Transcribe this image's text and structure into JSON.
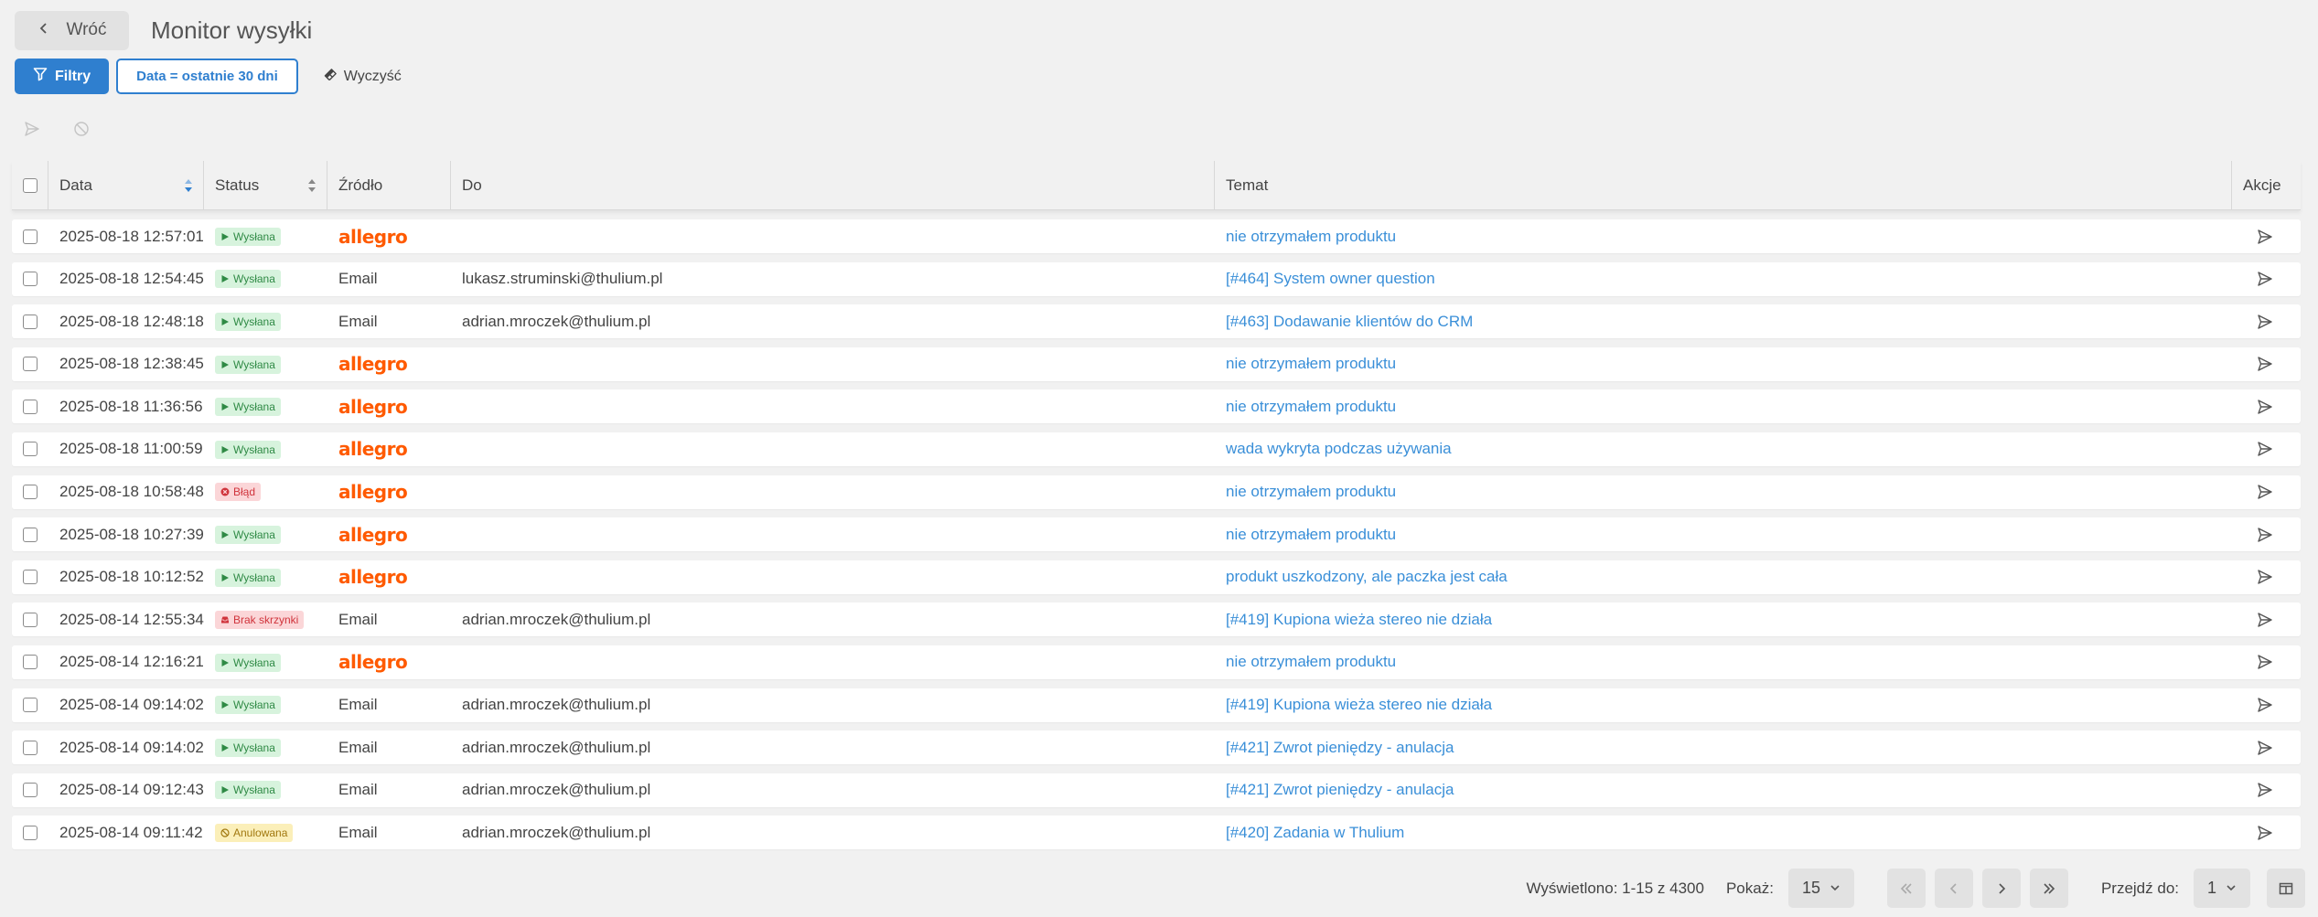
{
  "header": {
    "back_label": "Wróć",
    "title": "Monitor wysyłki"
  },
  "filters": {
    "filter_button": "Filtry",
    "active_chip": "Data = ostatnie 30 dni",
    "clear_button": "Wyczyść"
  },
  "table": {
    "columns": {
      "date": "Data",
      "status": "Status",
      "source": "Źródło",
      "to": "Do",
      "subject": "Temat",
      "actions": "Akcje"
    },
    "rows": [
      {
        "date": "2025-08-18 12:57:01",
        "status": "Wysłana",
        "status_kind": "sent",
        "source": "allegro",
        "to": "",
        "subject": "nie otrzymałem produktu"
      },
      {
        "date": "2025-08-18 12:54:45",
        "status": "Wysłana",
        "status_kind": "sent",
        "source": "Email",
        "to": "lukasz.struminski@thulium.pl",
        "subject": "[#464] System owner question"
      },
      {
        "date": "2025-08-18 12:48:18",
        "status": "Wysłana",
        "status_kind": "sent",
        "source": "Email",
        "to": "adrian.mroczek@thulium.pl",
        "subject": "[#463] Dodawanie klientów do CRM"
      },
      {
        "date": "2025-08-18 12:38:45",
        "status": "Wysłana",
        "status_kind": "sent",
        "source": "allegro",
        "to": "",
        "subject": "nie otrzymałem produktu"
      },
      {
        "date": "2025-08-18 11:36:56",
        "status": "Wysłana",
        "status_kind": "sent",
        "source": "allegro",
        "to": "",
        "subject": "nie otrzymałem produktu"
      },
      {
        "date": "2025-08-18 11:00:59",
        "status": "Wysłana",
        "status_kind": "sent",
        "source": "allegro",
        "to": "",
        "subject": "wada wykryta podczas używania"
      },
      {
        "date": "2025-08-18 10:58:48",
        "status": "Błąd",
        "status_kind": "error",
        "source": "allegro",
        "to": "",
        "subject": "nie otrzymałem produktu"
      },
      {
        "date": "2025-08-18 10:27:39",
        "status": "Wysłana",
        "status_kind": "sent",
        "source": "allegro",
        "to": "",
        "subject": "nie otrzymałem produktu"
      },
      {
        "date": "2025-08-18 10:12:52",
        "status": "Wysłana",
        "status_kind": "sent",
        "source": "allegro",
        "to": "",
        "subject": "produkt uszkodzony, ale paczka jest cała"
      },
      {
        "date": "2025-08-14 12:55:34",
        "status": "Brak skrzynki",
        "status_kind": "nobox",
        "source": "Email",
        "to": "adrian.mroczek@thulium.pl",
        "subject": "[#419] Kupiona wieża stereo nie działa"
      },
      {
        "date": "2025-08-14 12:16:21",
        "status": "Wysłana",
        "status_kind": "sent",
        "source": "allegro",
        "to": "",
        "subject": "nie otrzymałem produktu"
      },
      {
        "date": "2025-08-14 09:14:02",
        "status": "Wysłana",
        "status_kind": "sent",
        "source": "Email",
        "to": "adrian.mroczek@thulium.pl",
        "subject": "[#419] Kupiona wieża stereo nie działa"
      },
      {
        "date": "2025-08-14 09:14:02",
        "status": "Wysłana",
        "status_kind": "sent",
        "source": "Email",
        "to": "adrian.mroczek@thulium.pl",
        "subject": "[#421] Zwrot pieniędzy - anulacja"
      },
      {
        "date": "2025-08-14 09:12:43",
        "status": "Wysłana",
        "status_kind": "sent",
        "source": "Email",
        "to": "adrian.mroczek@thulium.pl",
        "subject": "[#421] Zwrot pieniędzy - anulacja"
      },
      {
        "date": "2025-08-14 09:11:42",
        "status": "Anulowana",
        "status_kind": "cancelled",
        "source": "Email",
        "to": "adrian.mroczek@thulium.pl",
        "subject": "[#420] Zadania w Thulium"
      }
    ]
  },
  "pagination": {
    "shown_label": "Wyświetlono: 1-15 z 4300",
    "show_label": "Pokaż:",
    "page_size": "15",
    "goto_label": "Przejdź do:",
    "page": "1"
  },
  "colors": {
    "primary": "#2f7fcf",
    "link": "#3a8fd8",
    "allegro": "#ff5a00"
  }
}
